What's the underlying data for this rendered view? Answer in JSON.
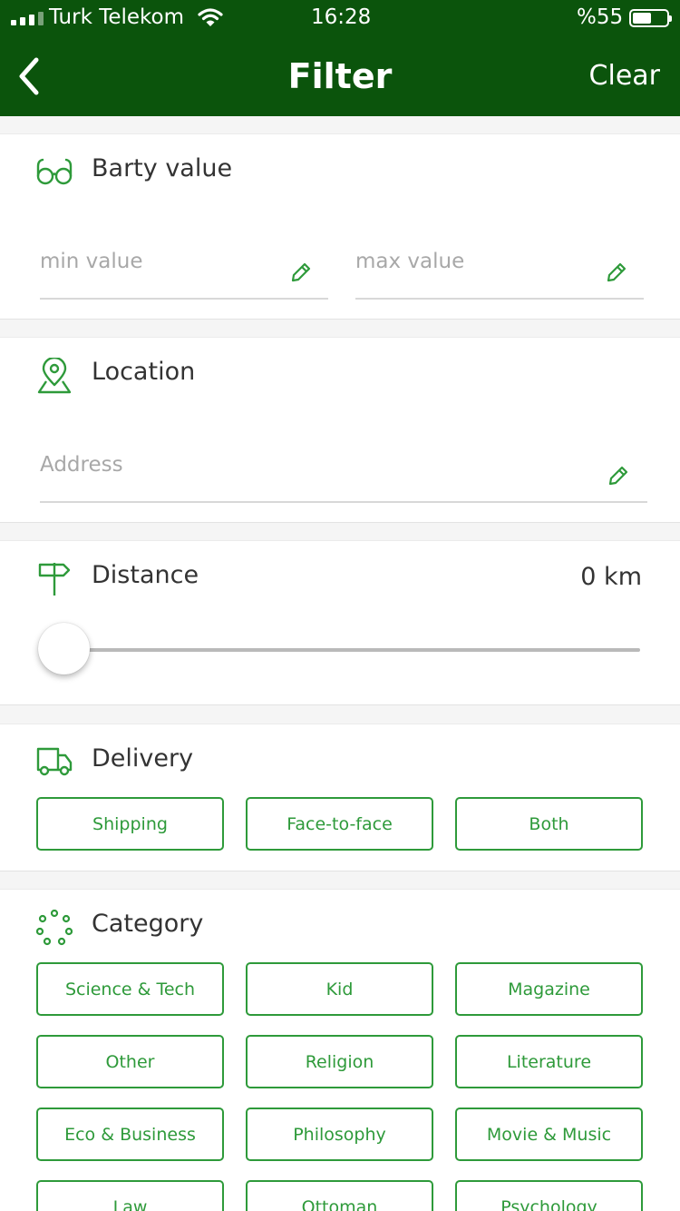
{
  "status_bar": {
    "carrier": "Turk Telekom",
    "time": "16:28",
    "battery": "%55"
  },
  "nav": {
    "title": "Filter",
    "clear_label": "Clear"
  },
  "colors": {
    "header": "#0b540c",
    "accent": "#2e9a3a"
  },
  "barty": {
    "title": "Barty value",
    "icon": "glasses-icon",
    "min_placeholder": "min value",
    "max_placeholder": "max value",
    "min_value": "",
    "max_value": ""
  },
  "location": {
    "title": "Location",
    "icon": "location-pin-icon",
    "placeholder": "Address",
    "value": ""
  },
  "distance": {
    "title": "Distance",
    "icon": "signpost-icon",
    "value_label": "0 km",
    "slider_value": 0
  },
  "delivery": {
    "title": "Delivery",
    "icon": "truck-icon",
    "options": [
      "Shipping",
      "Face-to-face",
      "Both"
    ]
  },
  "category": {
    "title": "Category",
    "icon": "dots-circle-icon",
    "options": [
      "Science & Tech",
      "Kid",
      "Magazine",
      "Other",
      "Religion",
      "Literature",
      "Eco & Business",
      "Philosophy",
      "Movie & Music",
      "Law",
      "Ottoman",
      "Psychology"
    ]
  }
}
